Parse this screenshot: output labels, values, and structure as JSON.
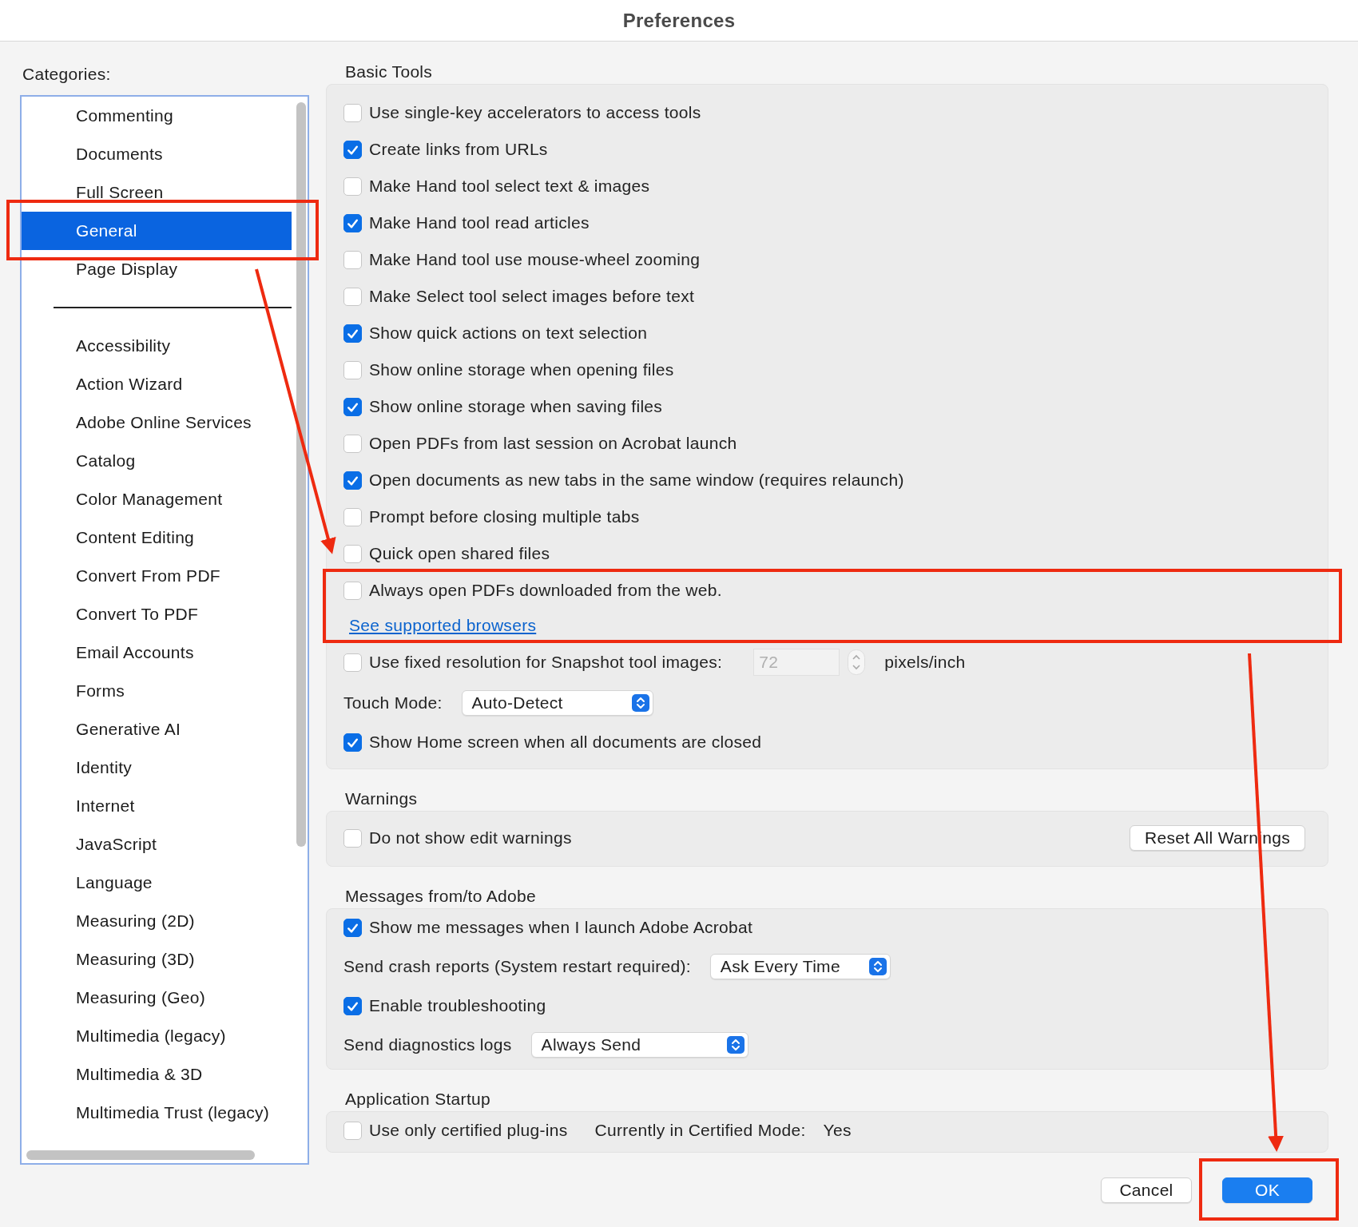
{
  "window": {
    "title": "Preferences"
  },
  "categories": {
    "label": "Categories:",
    "items": [
      {
        "kind": "item",
        "label": "Commenting",
        "selected": false
      },
      {
        "kind": "item",
        "label": "Documents",
        "selected": false
      },
      {
        "kind": "item",
        "label": "Full Screen",
        "selected": false
      },
      {
        "kind": "item",
        "label": "General",
        "selected": true
      },
      {
        "kind": "item",
        "label": "Page Display",
        "selected": false
      },
      {
        "kind": "separator"
      },
      {
        "kind": "item",
        "label": "Accessibility",
        "selected": false
      },
      {
        "kind": "item",
        "label": "Action Wizard",
        "selected": false
      },
      {
        "kind": "item",
        "label": "Adobe Online Services",
        "selected": false
      },
      {
        "kind": "item",
        "label": "Catalog",
        "selected": false
      },
      {
        "kind": "item",
        "label": "Color Management",
        "selected": false
      },
      {
        "kind": "item",
        "label": "Content Editing",
        "selected": false
      },
      {
        "kind": "item",
        "label": "Convert From PDF",
        "selected": false
      },
      {
        "kind": "item",
        "label": "Convert To PDF",
        "selected": false
      },
      {
        "kind": "item",
        "label": "Email Accounts",
        "selected": false
      },
      {
        "kind": "item",
        "label": "Forms",
        "selected": false
      },
      {
        "kind": "item",
        "label": "Generative AI",
        "selected": false
      },
      {
        "kind": "item",
        "label": "Identity",
        "selected": false
      },
      {
        "kind": "item",
        "label": "Internet",
        "selected": false
      },
      {
        "kind": "item",
        "label": "JavaScript",
        "selected": false
      },
      {
        "kind": "item",
        "label": "Language",
        "selected": false
      },
      {
        "kind": "item",
        "label": "Measuring (2D)",
        "selected": false
      },
      {
        "kind": "item",
        "label": "Measuring (3D)",
        "selected": false
      },
      {
        "kind": "item",
        "label": "Measuring (Geo)",
        "selected": false
      },
      {
        "kind": "item",
        "label": "Multimedia (legacy)",
        "selected": false
      },
      {
        "kind": "item",
        "label": "Multimedia & 3D",
        "selected": false
      },
      {
        "kind": "item",
        "label": "Multimedia Trust (legacy)",
        "selected": false
      }
    ]
  },
  "sections": [
    {
      "title": "Basic Tools",
      "rows": [
        {
          "kind": "checkbox",
          "label": "Use single-key accelerators to access tools",
          "checked": false
        },
        {
          "kind": "checkbox",
          "label": "Create links from URLs",
          "checked": true
        },
        {
          "kind": "checkbox",
          "label": "Make Hand tool select text & images",
          "checked": false
        },
        {
          "kind": "checkbox",
          "label": "Make Hand tool read articles",
          "checked": true
        },
        {
          "kind": "checkbox",
          "label": "Make Hand tool use mouse-wheel zooming",
          "checked": false
        },
        {
          "kind": "checkbox",
          "label": "Make Select tool select images before text",
          "checked": false
        },
        {
          "kind": "checkbox",
          "label": "Show quick actions on text selection",
          "checked": true
        },
        {
          "kind": "checkbox",
          "label": "Show online storage when opening files",
          "checked": false
        },
        {
          "kind": "checkbox",
          "label": "Show online storage when saving files",
          "checked": true
        },
        {
          "kind": "checkbox",
          "label": "Open PDFs from last session on Acrobat launch",
          "checked": false
        },
        {
          "kind": "checkbox",
          "label": "Open documents as new tabs in the same window (requires relaunch)",
          "checked": true
        },
        {
          "kind": "checkbox",
          "label": "Prompt before closing multiple tabs",
          "checked": false
        },
        {
          "kind": "checkbox",
          "label": "Quick open shared files",
          "checked": false
        },
        {
          "kind": "checkbox",
          "label": "Always open PDFs downloaded from the web.",
          "checked": false
        },
        {
          "kind": "link",
          "label": "See supported browsers"
        },
        {
          "kind": "resolution",
          "label": "Use fixed resolution for Snapshot tool images:",
          "checked": false,
          "value": "72",
          "disabled": true,
          "unit": "pixels/inch"
        },
        {
          "kind": "select",
          "label": "Touch Mode:",
          "value": "Auto-Detect"
        },
        {
          "kind": "checkbox",
          "label": "Show Home screen when all documents are closed",
          "checked": true
        }
      ]
    },
    {
      "title": "Warnings",
      "rows": [
        {
          "kind": "checkbox_button",
          "label": "Do not show edit warnings",
          "checked": false,
          "button": "Reset All Warnings"
        }
      ]
    },
    {
      "title": "Messages from/to Adobe",
      "rows": [
        {
          "kind": "checkbox",
          "label": "Show me messages when I launch Adobe Acrobat",
          "checked": true
        },
        {
          "kind": "select",
          "label": "Send crash reports (System restart required):",
          "value": "Ask Every Time"
        },
        {
          "kind": "checkbox",
          "label": "Enable troubleshooting",
          "checked": true
        },
        {
          "kind": "select",
          "label": "Send diagnostics logs",
          "value": "Always Send"
        }
      ]
    },
    {
      "title": "Application Startup",
      "rows": [
        {
          "kind": "status",
          "label": "Use only certified plug-ins",
          "checked": false,
          "status_label": "Currently in Certified Mode:",
          "status": "Yes"
        }
      ]
    }
  ],
  "buttons": [
    {
      "kind": "secondary",
      "label": "Cancel"
    },
    {
      "kind": "primary",
      "label": "OK"
    }
  ]
}
